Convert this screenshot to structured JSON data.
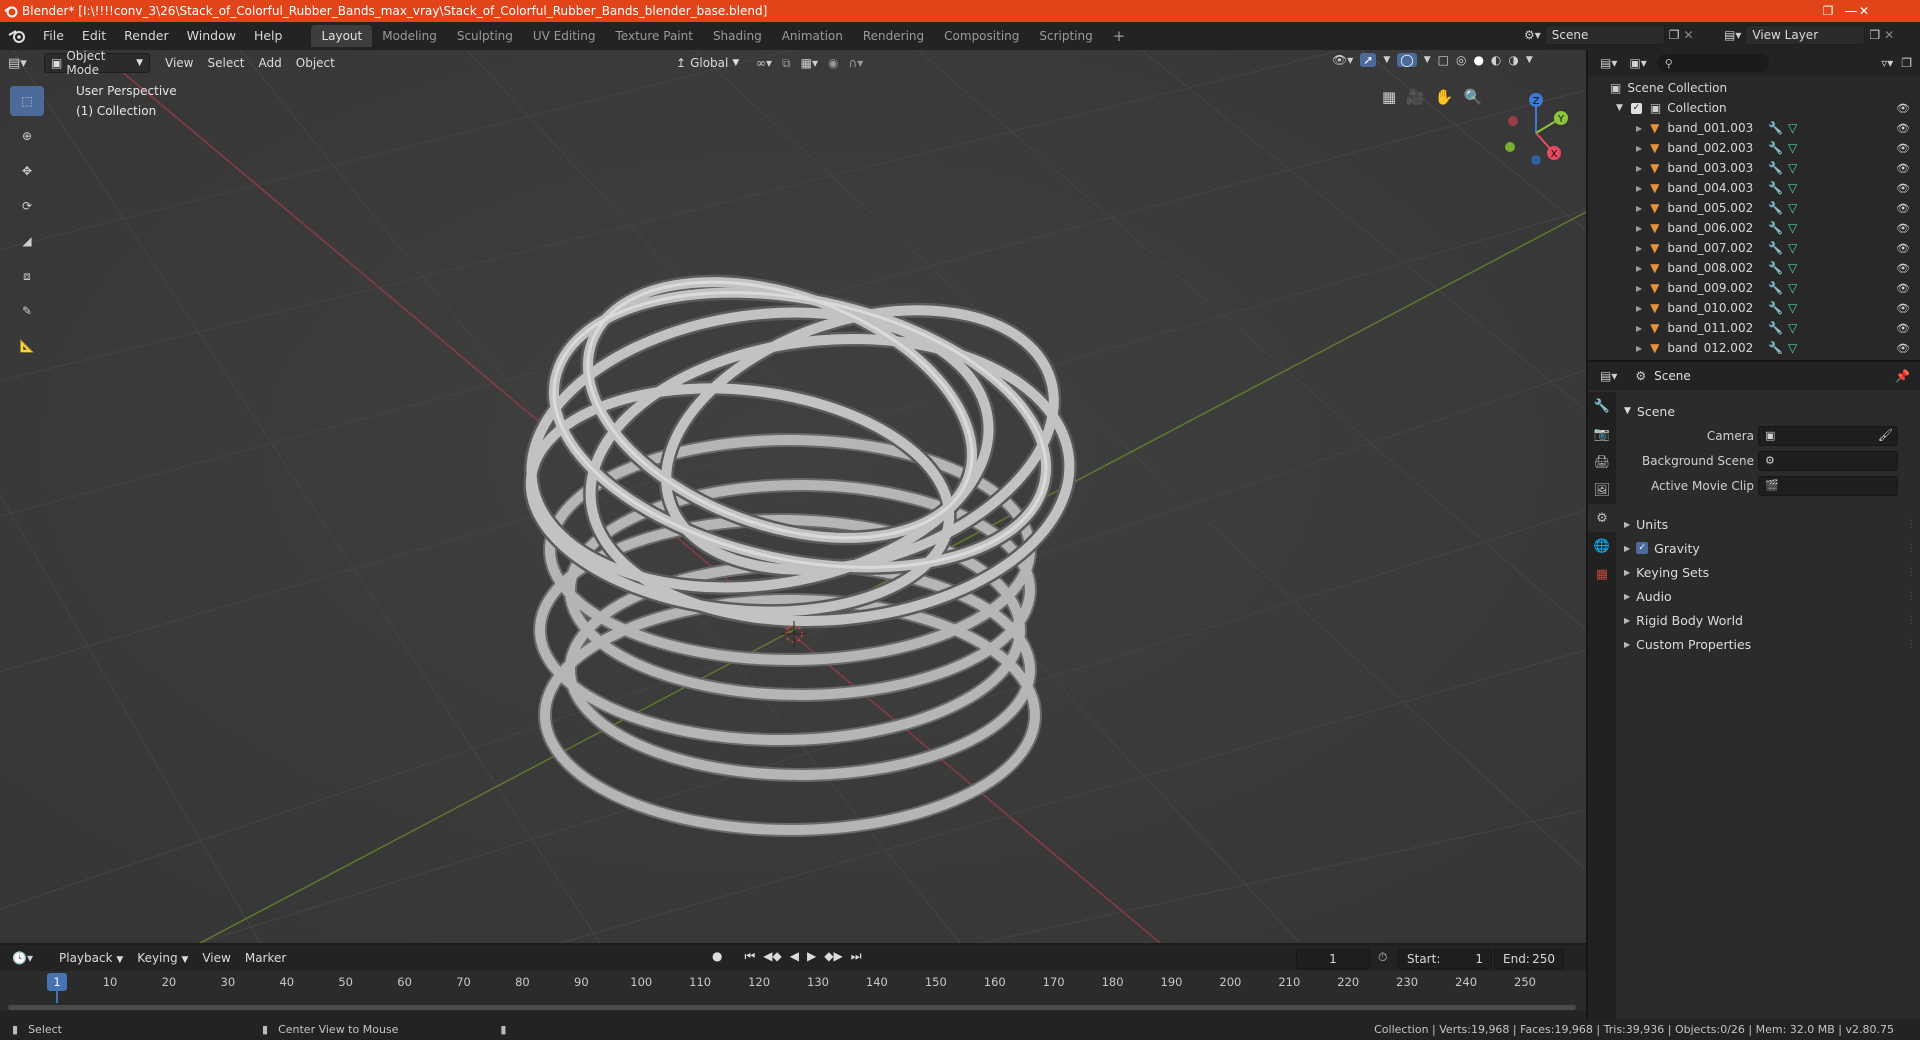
{
  "window": {
    "title": "Blender* [I:\\!!!!conv_3\\26\\Stack_of_Colorful_Rubber_Bands_max_vray\\Stack_of_Colorful_Rubber_Bands_blender_base.blend]"
  },
  "menu": [
    "File",
    "Edit",
    "Render",
    "Window",
    "Help"
  ],
  "workspaces": [
    {
      "label": "Layout",
      "active": true
    },
    {
      "label": "Modeling",
      "active": false
    },
    {
      "label": "Sculpting",
      "active": false
    },
    {
      "label": "UV Editing",
      "active": false
    },
    {
      "label": "Texture Paint",
      "active": false
    },
    {
      "label": "Shading",
      "active": false
    },
    {
      "label": "Animation",
      "active": false
    },
    {
      "label": "Rendering",
      "active": false
    },
    {
      "label": "Compositing",
      "active": false
    },
    {
      "label": "Scripting",
      "active": false
    }
  ],
  "scene_selector": {
    "value": "Scene"
  },
  "view_layer_selector": {
    "value": "View Layer"
  },
  "viewport": {
    "mode": "Object Mode",
    "header_menus": [
      "View",
      "Select",
      "Add",
      "Object"
    ],
    "orientation": "Global",
    "perspective_label": "User Perspective",
    "collection_label": "(1) Collection",
    "gizmo_axes": {
      "x": "X",
      "y": "Y",
      "z": "Z"
    },
    "axis_colors": {
      "x": "#e84a5f",
      "y": "#8cc43c",
      "z": "#3d7cd6"
    }
  },
  "outliner": {
    "root": "Scene Collection",
    "collection": "Collection",
    "objects": [
      "band_001.003",
      "band_002.003",
      "band_003.003",
      "band_004.003",
      "band_005.002",
      "band_006.002",
      "band_007.002",
      "band_008.002",
      "band_009.002",
      "band_010.002",
      "band_011.002",
      "band_012.002"
    ]
  },
  "properties": {
    "context": "Scene",
    "panel_title": "Scene",
    "camera_label": "Camera",
    "background_scene_label": "Background Scene",
    "active_movie_clip_label": "Active Movie Clip",
    "subpanels": [
      {
        "label": "Units",
        "checkbox": false
      },
      {
        "label": "Gravity",
        "checkbox": true
      },
      {
        "label": "Keying Sets",
        "checkbox": false
      },
      {
        "label": "Audio",
        "checkbox": false
      },
      {
        "label": "Rigid Body World",
        "checkbox": false
      },
      {
        "label": "Custom Properties",
        "checkbox": false
      }
    ]
  },
  "timeline": {
    "menus": [
      "Playback",
      "Keying",
      "View",
      "Marker"
    ],
    "current_frame": "1",
    "start_label": "Start:",
    "start": "1",
    "end_label": "End:",
    "end": "250",
    "ticks": [
      "1",
      "10",
      "20",
      "30",
      "40",
      "50",
      "60",
      "70",
      "80",
      "90",
      "100",
      "110",
      "120",
      "130",
      "140",
      "150",
      "160",
      "170",
      "180",
      "190",
      "200",
      "210",
      "220",
      "230",
      "240",
      "250"
    ]
  },
  "statusbar": {
    "left_action": "Select",
    "middle_action": "Center View to Mouse",
    "stats": "Collection | Verts:19,968 | Faces:19,968 | Tris:39,936 | Objects:0/26 | Mem: 32.0 MB | v2.80.75"
  },
  "colors": {
    "titlebar": "#e2441a",
    "active_tool": "#4c6b9b",
    "viewport_bg": "#393939",
    "mesh": "#b9b9b9"
  }
}
